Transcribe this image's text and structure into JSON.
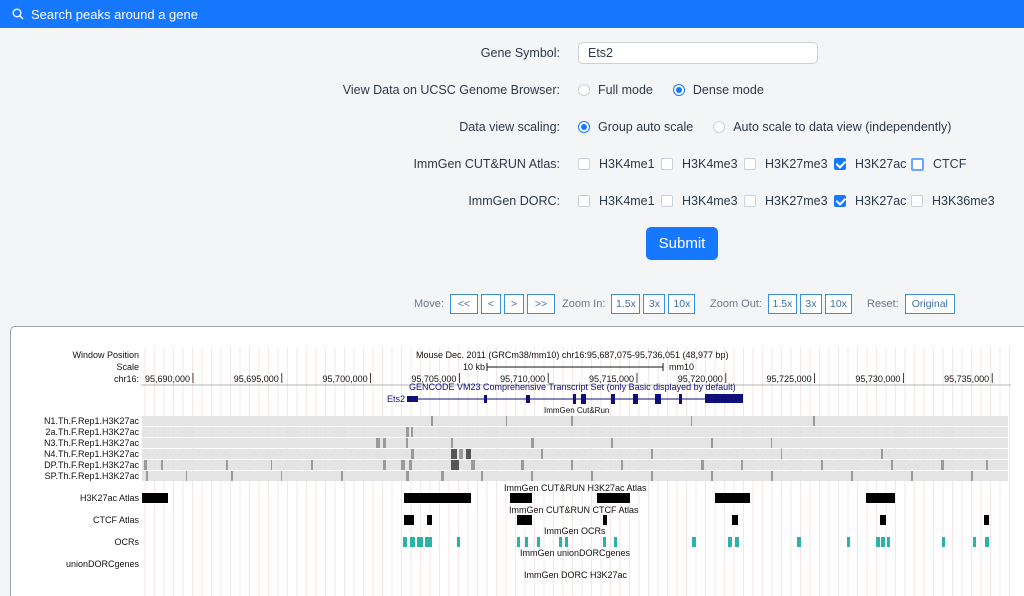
{
  "topbar": {
    "title": "Search peaks around a gene"
  },
  "form": {
    "gene_label": "Gene Symbol:",
    "gene_value": "Ets2",
    "view_label": "View Data on UCSC Genome Browser:",
    "view_options": [
      {
        "label": "Full mode",
        "selected": false
      },
      {
        "label": "Dense mode",
        "selected": true
      }
    ],
    "scaling_label": "Data view scaling:",
    "scaling_options": [
      {
        "label": "Group auto scale",
        "selected": true
      },
      {
        "label": "Auto scale to data view (independently)",
        "selected": false
      }
    ],
    "cutrun_label": "ImmGen CUT&RUN Atlas:",
    "cutrun_options": [
      {
        "label": "H3K4me1",
        "checked": false
      },
      {
        "label": "H3K4me3",
        "checked": false
      },
      {
        "label": "H3K27me3",
        "checked": false
      },
      {
        "label": "H3K27ac",
        "checked": true
      },
      {
        "label": "CTCF",
        "checked": false
      }
    ],
    "dorc_label": "ImmGen DORC:",
    "dorc_options": [
      {
        "label": "H3K4me1",
        "checked": false
      },
      {
        "label": "H3K4me3",
        "checked": false
      },
      {
        "label": "H3K27me3",
        "checked": false
      },
      {
        "label": "H3K27ac",
        "checked": true
      },
      {
        "label": "H3K36me3",
        "checked": false
      }
    ],
    "submit_label": "Submit"
  },
  "nav": {
    "move_label": "Move:",
    "move_buttons": [
      "<<",
      "<",
      ">",
      ">>"
    ],
    "zoom_in_label": "Zoom In:",
    "zoom_in_buttons": [
      "1.5x",
      "3x",
      "10x"
    ],
    "zoom_out_label": "Zoom Out:",
    "zoom_out_buttons": [
      "1.5x",
      "3x",
      "10x"
    ],
    "reset_label": "Reset:",
    "reset_button": "Original"
  },
  "browser": {
    "window_position_label": "Window Position",
    "scale_label": "Scale",
    "chrom_label": "chr16:",
    "assembly_text": "Mouse Dec. 2011 (GRCm38/mm10)   chr16:95,687,075-95,736,051 (48,977 bp)",
    "scale_text": "10 kb",
    "scale_assembly": "mm10",
    "positions": [
      "95,690,000",
      "95,695,000",
      "95,700,000",
      "95,705,000",
      "95,710,000",
      "95,715,000",
      "95,720,000",
      "95,725,000",
      "95,730,000",
      "95,735,000"
    ],
    "gencode_text": "GENCODE VM23 Comprehensive Transcript Set (only Basic displayed by default)",
    "gene_name": "Ets2",
    "cutrun_group_text": "ImmGen Cut&Run",
    "signal_tracks": [
      "N1.Th.F.Rep1.H3K27ac",
      "2a.Th.F.Rep1.H3K27ac",
      "N3.Th.F.Rep1.H3K27ac",
      "N4.Th.F.Rep1.H3K27ac",
      "DP.Th.F.Rep1.H3K27ac",
      "SP.Th.F.Rep1.H3K27ac"
    ],
    "h3k27ac_atlas_label": "H3K27ac Atlas",
    "h3k27ac_atlas_title": "ImmGen CUT&RUN H3K27ac Atlas",
    "ctcf_atlas_label": "CTCF Atlas",
    "ctcf_atlas_title": "ImmGen CUT&RUN CTCF Atlas",
    "ocrs_label": "OCRs",
    "ocrs_title": "ImmGen OCRs",
    "union_title": "ImmGen unionDORCgenes",
    "union_label": "unionDORCgenes",
    "dorc_title": "ImmGen DORC H3K27ac",
    "colors": {
      "ocr": "#2ab3a6",
      "gene": "#0f0f7a",
      "accent": "#1677ff"
    }
  }
}
